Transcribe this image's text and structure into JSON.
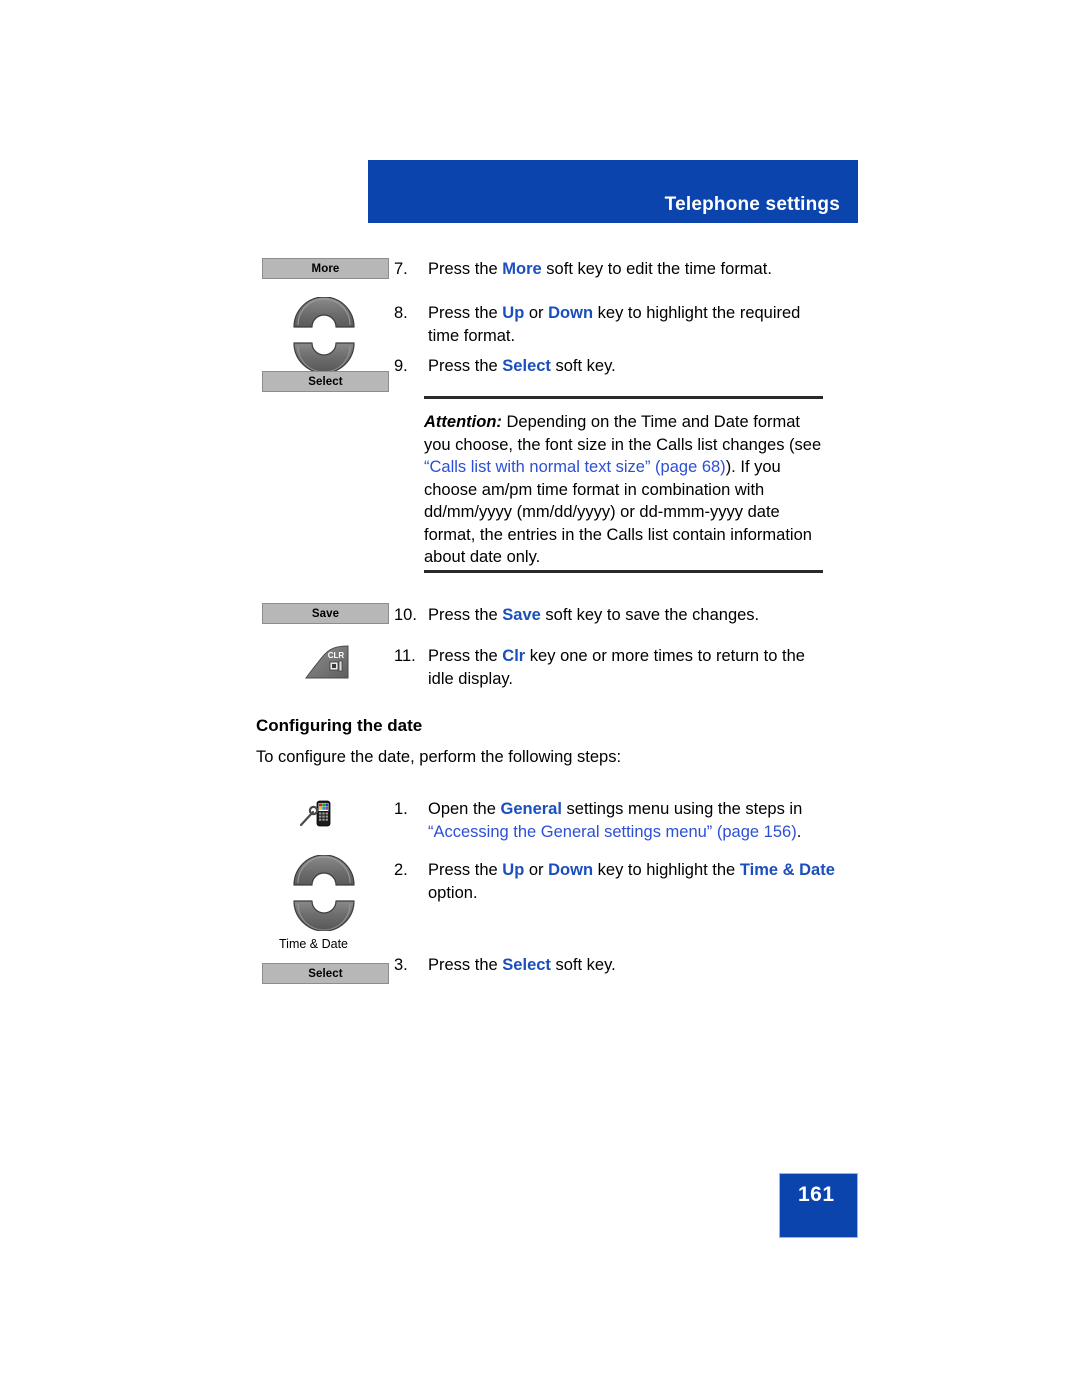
{
  "header": {
    "title": "Telephone settings",
    "banner_color": "#0b44ac"
  },
  "controls": {
    "more_key_label": "More",
    "select_key_label": "Select",
    "save_key_label": "Save",
    "clr_key_label": "CLR",
    "nav_caption": "Time & Date"
  },
  "steps_time_format": [
    {
      "number": "7.",
      "segments": [
        {
          "text": "Press the ",
          "style": "plain"
        },
        {
          "text": "More",
          "style": "blue-bold"
        },
        {
          "text": " soft key to edit the time format.",
          "style": "plain"
        }
      ]
    },
    {
      "number": "8.",
      "segments": [
        {
          "text": "Press the ",
          "style": "plain"
        },
        {
          "text": "Up",
          "style": "blue-bold"
        },
        {
          "text": " or ",
          "style": "plain"
        },
        {
          "text": "Down",
          "style": "blue-bold"
        },
        {
          "text": " key to highlight the required time format.",
          "style": "plain"
        }
      ]
    },
    {
      "number": "9.",
      "segments": [
        {
          "text": "Press the ",
          "style": "plain"
        },
        {
          "text": "Select",
          "style": "blue-bold"
        },
        {
          "text": " soft key.",
          "style": "plain"
        }
      ]
    },
    {
      "number": "10.",
      "segments": [
        {
          "text": "Press the ",
          "style": "plain"
        },
        {
          "text": "Save",
          "style": "blue-bold"
        },
        {
          "text": " soft key to save the changes.",
          "style": "plain"
        }
      ]
    },
    {
      "number": "11.",
      "segments": [
        {
          "text": "Press the ",
          "style": "plain"
        },
        {
          "text": "Clr",
          "style": "blue-bold"
        },
        {
          "text": " key one or more times to return to the idle display.",
          "style": "plain"
        }
      ]
    }
  ],
  "attention": {
    "label": "Attention:",
    "line1": " Depending on the Time and Date format you choose, the font size in the Calls list changes (see ",
    "xref_text": "“Calls list with normal text size” (page 68)",
    "line2": ").",
    "line3": "If you choose am/pm time format in combination with dd/mm/yyyy (mm/dd/yyyy) or dd-mmm-yyyy date format, the entries in the Calls list contain information about date only."
  },
  "section": {
    "heading": "Configuring the date",
    "intro": "To configure the date, perform the following steps:"
  },
  "steps_configure_date": [
    {
      "number": "1.",
      "segments": [
        {
          "text": "Open the ",
          "style": "plain"
        },
        {
          "text": "General",
          "style": "blue-bold"
        },
        {
          "text": " settings menu using the steps in ",
          "style": "plain"
        },
        {
          "text": "“Accessing the General settings menu” (page 156)",
          "style": "xref"
        },
        {
          "text": ".",
          "style": "plain"
        }
      ]
    },
    {
      "number": "2.",
      "segments": [
        {
          "text": "Press the ",
          "style": "plain"
        },
        {
          "text": "Up",
          "style": "blue-bold"
        },
        {
          "text": " or ",
          "style": "plain"
        },
        {
          "text": "Down",
          "style": "blue-bold"
        },
        {
          "text": " key to highlight the ",
          "style": "plain"
        },
        {
          "text": "Time & Date",
          "style": "blue-bold"
        },
        {
          "text": " option.",
          "style": "plain"
        }
      ]
    },
    {
      "number": "3.",
      "segments": [
        {
          "text": "Press the ",
          "style": "plain"
        },
        {
          "text": "Select",
          "style": "blue-bold"
        },
        {
          "text": " soft key.",
          "style": "plain"
        }
      ]
    }
  ],
  "footer": {
    "page_number": "161"
  }
}
